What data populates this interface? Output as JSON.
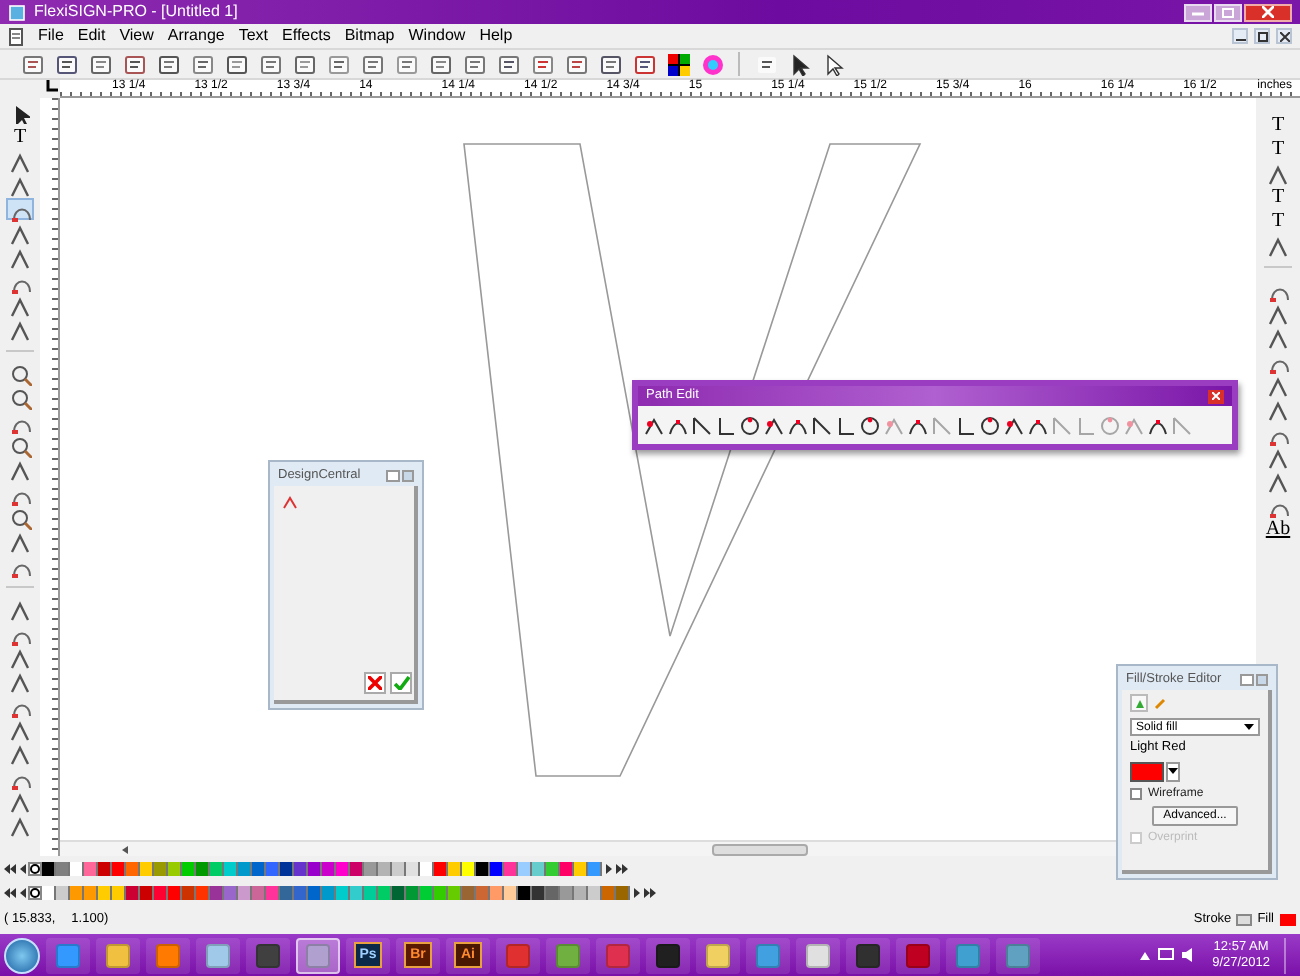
{
  "window": {
    "title": "FlexiSIGN-PRO - [Untitled 1]"
  },
  "menu": [
    "File",
    "Edit",
    "View",
    "Arrange",
    "Text",
    "Effects",
    "Bitmap",
    "Window",
    "Help"
  ],
  "ruler": {
    "labels": [
      "13 1/4",
      "13 1/2",
      "13 3/4",
      "14",
      "14 1/4",
      "14 1/2",
      "14 3/4",
      "15",
      "15 1/4",
      "15 1/2",
      "15 3/4",
      "16",
      "16 1/4",
      "16 1/2"
    ],
    "unit": "inches"
  },
  "left_tools": [
    {
      "kind": "arrow"
    },
    {
      "kind": "glyph",
      "label": "T"
    },
    {
      "kind": "tool"
    },
    {
      "kind": "tool"
    },
    {
      "kind": "tool",
      "selected": true
    },
    {
      "kind": "tool"
    },
    {
      "kind": "tool"
    },
    {
      "kind": "tool"
    },
    {
      "kind": "tool"
    },
    {
      "kind": "tool"
    },
    {
      "kind": "gap"
    },
    {
      "kind": "zoom"
    },
    {
      "kind": "zoom"
    },
    {
      "kind": "tool"
    },
    {
      "kind": "zoom"
    },
    {
      "kind": "tool"
    },
    {
      "kind": "tool"
    },
    {
      "kind": "zoom"
    },
    {
      "kind": "tool"
    },
    {
      "kind": "tool"
    },
    {
      "kind": "gap"
    },
    {
      "kind": "tool"
    },
    {
      "kind": "tool"
    },
    {
      "kind": "tool"
    },
    {
      "kind": "tool"
    },
    {
      "kind": "tool"
    },
    {
      "kind": "tool"
    },
    {
      "kind": "tool"
    },
    {
      "kind": "tool"
    },
    {
      "kind": "tool"
    },
    {
      "kind": "tool"
    }
  ],
  "right_tools": [
    {
      "kind": "glyph",
      "label": "T"
    },
    {
      "kind": "glyph",
      "label": "T"
    },
    {
      "kind": "tool"
    },
    {
      "kind": "glyph",
      "label": "T"
    },
    {
      "kind": "glyph",
      "label": "T"
    },
    {
      "kind": "tool"
    },
    {
      "kind": "gap"
    },
    {
      "kind": "tool"
    },
    {
      "kind": "tool"
    },
    {
      "kind": "tool"
    },
    {
      "kind": "tool"
    },
    {
      "kind": "tool"
    },
    {
      "kind": "tool"
    },
    {
      "kind": "tool"
    },
    {
      "kind": "tool"
    },
    {
      "kind": "tool"
    },
    {
      "kind": "tool"
    },
    {
      "kind": "glyph",
      "label": "Ab"
    }
  ],
  "path_edit": {
    "title": "Path Edit",
    "tools": [
      {
        "disabled": false
      },
      {
        "disabled": false
      },
      {
        "disabled": false
      },
      {
        "disabled": false
      },
      {
        "disabled": false
      },
      {
        "disabled": false
      },
      {
        "disabled": false
      },
      {
        "disabled": false
      },
      {
        "disabled": false
      },
      {
        "disabled": false
      },
      {
        "disabled": true
      },
      {
        "disabled": false
      },
      {
        "disabled": true
      },
      {
        "disabled": false
      },
      {
        "disabled": false
      },
      {
        "disabled": false
      },
      {
        "disabled": false
      },
      {
        "disabled": true
      },
      {
        "disabled": true
      },
      {
        "disabled": true
      },
      {
        "disabled": true
      },
      {
        "disabled": false
      },
      {
        "disabled": true
      }
    ]
  },
  "design_central": {
    "title": "DesignCentral"
  },
  "fill_stroke": {
    "title": "Fill/Stroke Editor",
    "fill_type": "Solid fill",
    "color_name": "Light Red",
    "color": "#ff0000",
    "wireframe": {
      "label": "Wireframe",
      "checked": false
    },
    "advanced": "Advanced...",
    "overprint": {
      "label": "Overprint",
      "checked": false,
      "disabled": true
    }
  },
  "palette_rows": [
    {
      "swatches": [
        {
          "color": "#000000"
        },
        {
          "color": "#808080"
        },
        {
          "color": "#ffffff"
        },
        {
          "color": "#ff6699"
        },
        {
          "color": "#cc0000"
        },
        {
          "color": "#ff0000"
        },
        {
          "color": "#ff6600"
        },
        {
          "color": "#ffcc00"
        },
        {
          "color": "#999900"
        },
        {
          "color": "#99cc00"
        },
        {
          "color": "#00cc00"
        },
        {
          "color": "#009900"
        },
        {
          "color": "#00cc66"
        },
        {
          "color": "#00cccc"
        },
        {
          "color": "#0099cc"
        },
        {
          "color": "#0066cc"
        },
        {
          "color": "#3366ff"
        },
        {
          "color": "#003399"
        },
        {
          "color": "#6633cc"
        },
        {
          "color": "#9900cc"
        },
        {
          "color": "#cc00cc"
        },
        {
          "color": "#ff00cc"
        },
        {
          "color": "#cc0066"
        },
        {
          "color": "#999999"
        },
        {
          "color": "#b3b3b3"
        },
        {
          "color": "#cccccc"
        },
        {
          "color": "#e0e0e0"
        },
        {
          "color": "#ffffff"
        },
        {
          "color": "#ff0000"
        },
        {
          "color": "#ffcc00"
        },
        {
          "color": "#ffff00"
        },
        {
          "color": "#000000"
        },
        {
          "color": "#0000ff"
        },
        {
          "color": "#ff3399"
        },
        {
          "color": "#99ccff"
        },
        {
          "color": "#66cccc"
        },
        {
          "color": "#33cc33"
        },
        {
          "color": "#ff0066"
        },
        {
          "color": "#ffcc00"
        },
        {
          "color": "#3399ff"
        }
      ]
    },
    {
      "swatches": [
        {
          "color": "#ffffff"
        },
        {
          "color": "#cccccc"
        },
        {
          "color": "#ff9900"
        },
        {
          "color": "#ff9900"
        },
        {
          "color": "#ffcc00"
        },
        {
          "color": "#ffcc00"
        },
        {
          "color": "#cc0033"
        },
        {
          "color": "#cc0000"
        },
        {
          "color": "#ff0033"
        },
        {
          "color": "#ff0000"
        },
        {
          "color": "#cc3300"
        },
        {
          "color": "#ff3300"
        },
        {
          "color": "#993399"
        },
        {
          "color": "#9966cc"
        },
        {
          "color": "#cc99cc"
        },
        {
          "color": "#cc6699"
        },
        {
          "color": "#ff3399"
        },
        {
          "color": "#336699"
        },
        {
          "color": "#3366cc"
        },
        {
          "color": "#0066cc"
        },
        {
          "color": "#0099cc"
        },
        {
          "color": "#00cccc"
        },
        {
          "color": "#33cccc"
        },
        {
          "color": "#00cc99"
        },
        {
          "color": "#00cc66"
        },
        {
          "color": "#006633"
        },
        {
          "color": "#009933"
        },
        {
          "color": "#00cc33"
        },
        {
          "color": "#33cc00"
        },
        {
          "color": "#66cc00"
        },
        {
          "color": "#996633"
        },
        {
          "color": "#cc6633"
        },
        {
          "color": "#ff9966"
        },
        {
          "color": "#ffcc99"
        },
        {
          "color": "#000000"
        },
        {
          "color": "#333333"
        },
        {
          "color": "#666666"
        },
        {
          "color": "#999999"
        },
        {
          "color": "#b3b3b3"
        },
        {
          "color": "#cccccc"
        },
        {
          "color": "#cc6600"
        },
        {
          "color": "#996600"
        }
      ]
    }
  ],
  "status": {
    "coord_x": "( 15.833,",
    "coord_y": "1.100)",
    "stroke_label": "Stroke",
    "fill_label": "Fill",
    "fill_swatch": {
      "color": "#ff0000"
    }
  },
  "taskbar": {
    "items": [
      {
        "kind": "icon",
        "color": "#3399ff"
      },
      {
        "kind": "icon",
        "color": "#f0c040"
      },
      {
        "kind": "icon",
        "color": "#ff7a00"
      },
      {
        "kind": "icon",
        "color": "#a0c8e8"
      },
      {
        "kind": "icon",
        "color": "#404040"
      },
      {
        "kind": "icon",
        "color": "#b0a0d0",
        "selected": true
      },
      {
        "kind": "label",
        "label": "Ps",
        "color": "#0b2a4a"
      },
      {
        "kind": "label",
        "label": "Br",
        "color": "#5a1a00"
      },
      {
        "kind": "label",
        "label": "Ai",
        "color": "#4a1800"
      },
      {
        "kind": "icon",
        "color": "#e03030"
      },
      {
        "kind": "icon",
        "color": "#70b040"
      },
      {
        "kind": "icon",
        "color": "#e03050"
      },
      {
        "kind": "icon",
        "color": "#202020"
      },
      {
        "kind": "icon",
        "color": "#f0d060"
      },
      {
        "kind": "icon",
        "color": "#40a0e0"
      },
      {
        "kind": "icon",
        "color": "#e0e0e0"
      },
      {
        "kind": "icon",
        "color": "#303030"
      },
      {
        "kind": "icon",
        "color": "#c00020"
      },
      {
        "kind": "icon",
        "color": "#40a0d0"
      },
      {
        "kind": "icon",
        "color": "#60a0c0"
      }
    ],
    "time": "12:57 AM",
    "date": "9/27/2012"
  }
}
